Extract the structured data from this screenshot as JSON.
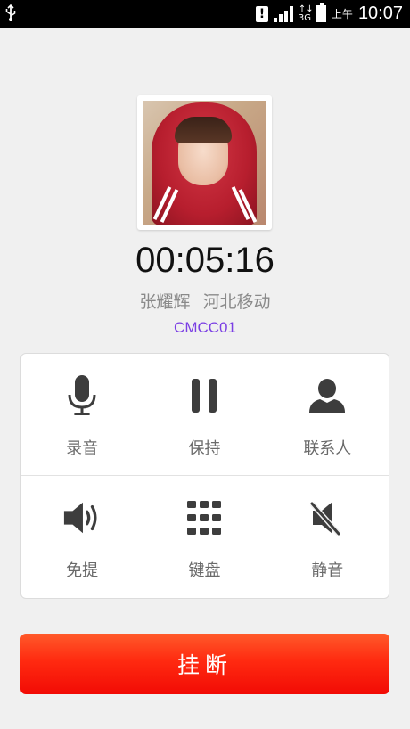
{
  "status_bar": {
    "ampm": "上午",
    "time": "10:07",
    "network_type": "3G",
    "icons": [
      "usb-icon",
      "alert-icon",
      "signal-icon",
      "data-arrows-icon",
      "battery-icon"
    ]
  },
  "call": {
    "timer": "00:05:16",
    "caller_name": "张耀辉",
    "caller_location": "河北移动",
    "network": "CMCC01"
  },
  "actions": [
    {
      "label": "录音",
      "icon": "microphone-icon"
    },
    {
      "label": "保持",
      "icon": "pause-icon"
    },
    {
      "label": "联系人",
      "icon": "contact-icon"
    },
    {
      "label": "免提",
      "icon": "speaker-icon"
    },
    {
      "label": "键盘",
      "icon": "keypad-icon"
    },
    {
      "label": "静音",
      "icon": "mute-icon"
    }
  ],
  "hangup": {
    "label": "挂断"
  },
  "colors": {
    "background": "#f0f0f0",
    "network_text": "#7b3fe4",
    "hangup_button": "#ff2a10",
    "icon": "#3d3d3d",
    "label": "#6a6a6a"
  }
}
